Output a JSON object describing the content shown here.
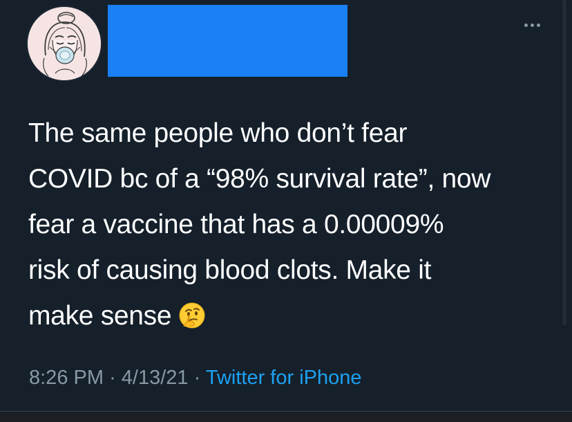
{
  "colors": {
    "background": "#15202b",
    "text": "#ffffff",
    "secondary_text": "#8899a6",
    "link": "#1da1f2",
    "redaction": "#1a80f5"
  },
  "header": {
    "avatar_icon": "sketch-girl-face-mask-avatar",
    "more_icon": "more-horizontal-icon"
  },
  "tweet": {
    "lines": [
      "The same people who don’t fear",
      "COVID bc of a “98% survival rate”, now",
      "fear a vaccine that has a 0.00009%",
      "risk of causing blood clots. Make it",
      "make sense"
    ],
    "emoji": "🤔"
  },
  "meta": {
    "time": "8:26 PM",
    "separator": "·",
    "date": "4/13/21",
    "source": "Twitter for iPhone"
  }
}
